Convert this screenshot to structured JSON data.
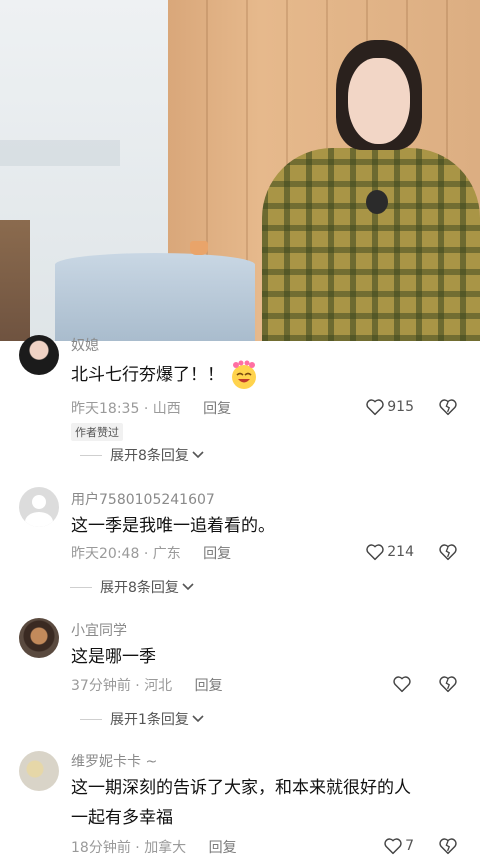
{
  "comments": [
    {
      "username": "奴媳",
      "text": "北斗七行夯爆了！！",
      "time": "昨天18:35",
      "location": "山西",
      "reply_label": "回复",
      "likes": "915",
      "badge": "作者赞过",
      "expand": "展开8条回复"
    },
    {
      "username": "用户7580105241607",
      "text": "这一季是我唯一追着看的。",
      "time": "昨天20:48",
      "location": "广东",
      "reply_label": "回复",
      "likes": "214",
      "expand": "展开8条回复"
    },
    {
      "username": "小宜同学",
      "text": "这是哪一季",
      "time": "37分钟前",
      "location": "河北",
      "reply_label": "回复",
      "likes": "",
      "expand": "展开1条回复"
    },
    {
      "username": "维罗妮卡卡 ~",
      "text_line1": "这一期深刻的告诉了大家，和本来就很好的人",
      "text_line2": "一起有多幸福",
      "time": "18分钟前",
      "location": "加拿大",
      "reply_label": "回复",
      "likes": "7"
    }
  ],
  "meta_separator": "·",
  "icons": {
    "like": "heart-outline-icon",
    "dislike": "broken-heart-icon",
    "expand": "chevron-down-icon"
  }
}
